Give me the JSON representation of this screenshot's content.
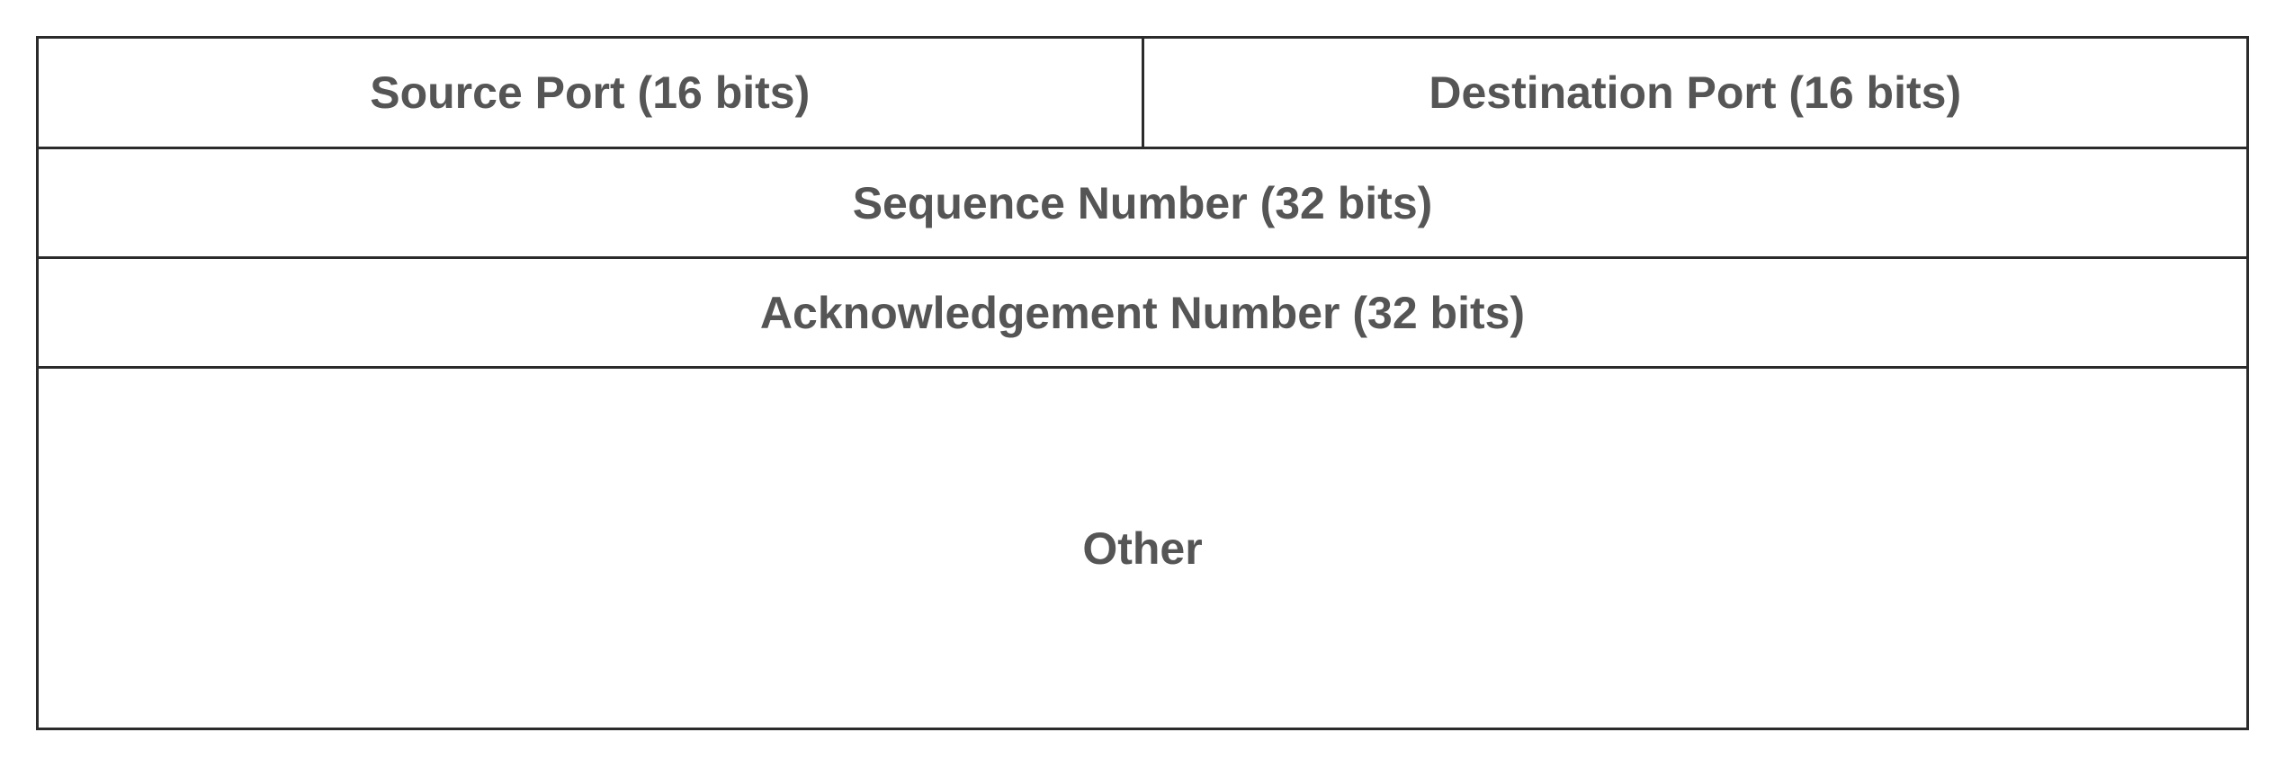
{
  "diagram": {
    "rows": [
      {
        "cells": [
          {
            "label": "Source Port (16 bits)"
          },
          {
            "label": "Destination Port (16 bits)"
          }
        ]
      },
      {
        "cells": [
          {
            "label": "Sequence Number (32 bits)"
          }
        ]
      },
      {
        "cells": [
          {
            "label": "Acknowledgement Number (32 bits)"
          }
        ]
      },
      {
        "cells": [
          {
            "label": "Other"
          }
        ]
      }
    ]
  }
}
